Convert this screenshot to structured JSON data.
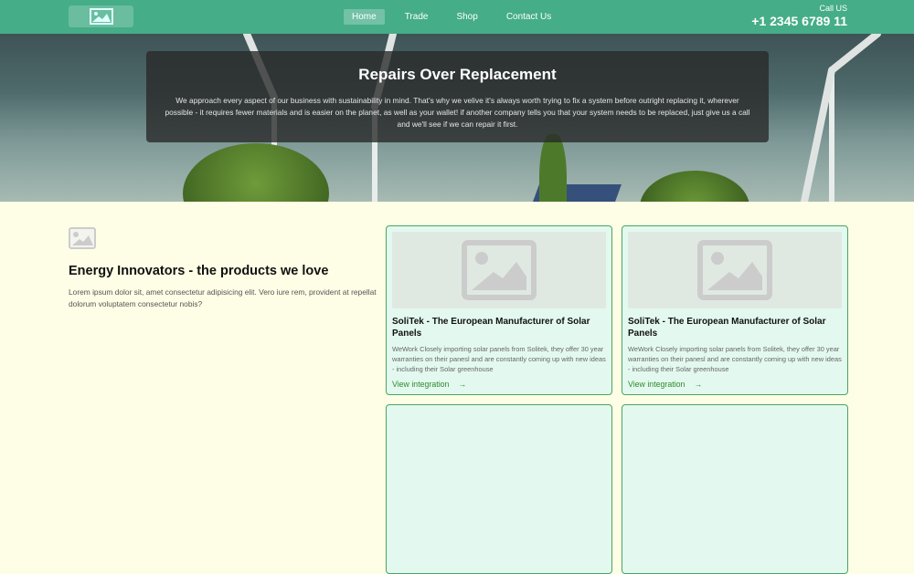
{
  "header": {
    "nav": [
      "Home",
      "Trade",
      "Shop",
      "Contact Us"
    ],
    "call_label": "Call US",
    "phone": "+1 2345 6789 11"
  },
  "hero": {
    "title": "Repairs Over Replacement",
    "text": "We approach every aspect of our business with sustainability in mind. That's why we velive it's always worth trying to fix a system before outright replacing it, wherever possible - it requires fewer materials and is easier on the planet, as well as your wallet! if another company tells you that your system needs to be replaced, just give us a call and we'll see if we can repair it first."
  },
  "intro": {
    "title": "Energy Innovators - the products we love",
    "text": "Lorem ipsum dolor sit, amet consectetur adipisicing elit. Vero iure rem, provident at repellat dolorum voluptatem consectetur nobis?"
  },
  "cards": [
    {
      "title": "SoliTek - The European Manufacturer of Solar Panels",
      "text": "WeWork Closely importing solar panels from Solitek, they offer 30 year warranties on their panesl and are constantly coming up with new ideas - including their Solar greenhouse",
      "link": "View integration"
    },
    {
      "title": "SoliTek - The European Manufacturer of Solar Panels",
      "text": "WeWork Closely importing solar panels from Solitek, they offer 30 year warranties on their panesl and are constantly coming up with new ideas - including their Solar greenhouse",
      "link": "View integration"
    }
  ],
  "colors": {
    "header": "#45ad88",
    "accent": "#2e8b2e",
    "background": "#fefee6"
  }
}
